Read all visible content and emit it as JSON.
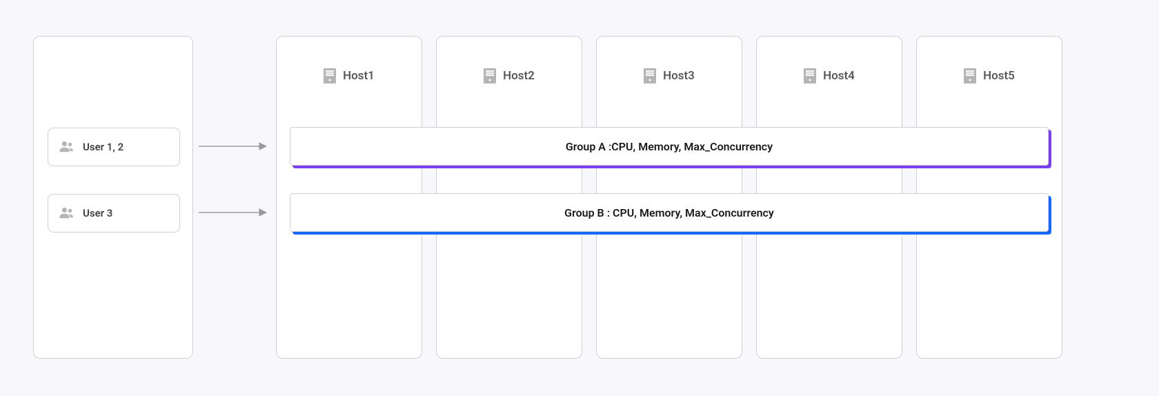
{
  "users": {
    "box1_label": "User 1, 2",
    "box2_label": "User 3"
  },
  "hosts": [
    {
      "label": "Host1"
    },
    {
      "label": "Host2"
    },
    {
      "label": "Host3"
    },
    {
      "label": "Host4"
    },
    {
      "label": "Host5"
    }
  ],
  "groups": {
    "a_label": "Group A :CPU, Memory, Max_Concurrency",
    "b_label": "Group B : CPU, Memory, Max_Concurrency"
  },
  "colors": {
    "group_a_shadow": "#7b3ff2",
    "group_b_shadow": "#1868ff"
  }
}
